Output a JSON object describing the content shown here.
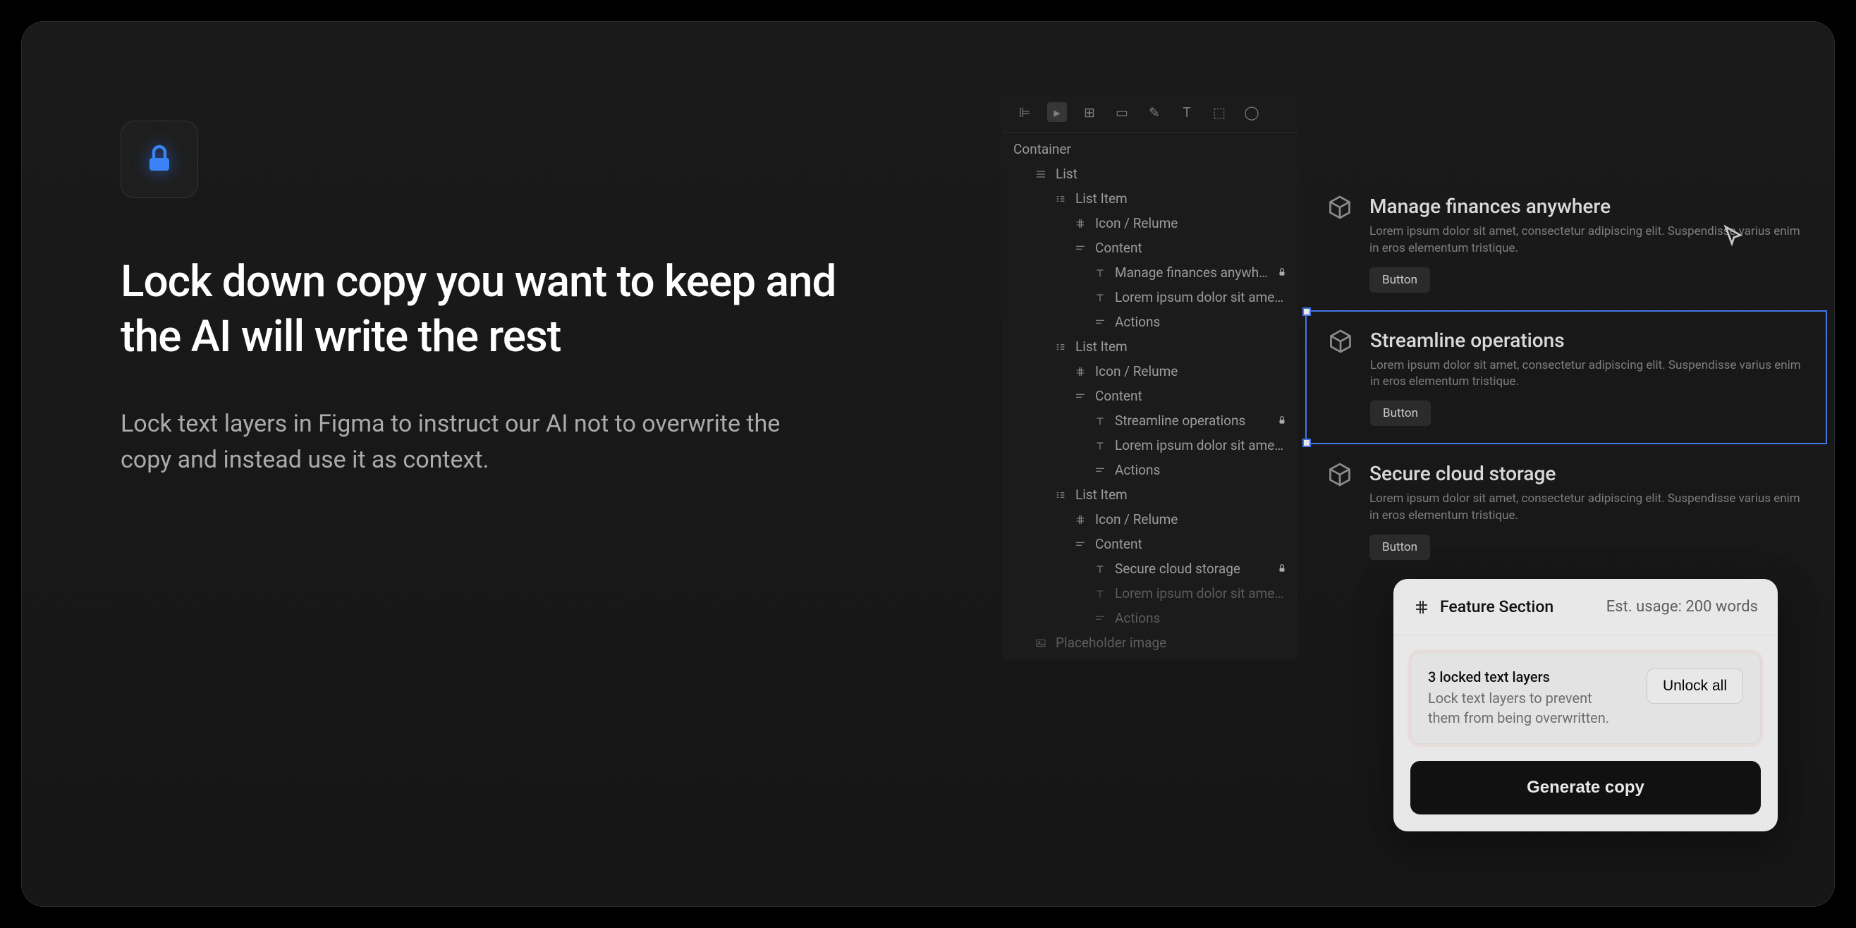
{
  "hero": {
    "heading": "Lock down copy you want to keep and the AI will write the rest",
    "subheading": "Lock text layers in Figma to instruct our AI not to overwrite the copy and instead use it as context."
  },
  "layers": {
    "root": "Container",
    "items": [
      {
        "indent": 1,
        "icon": "list",
        "label": "List"
      },
      {
        "indent": 2,
        "icon": "bars",
        "label": "List Item"
      },
      {
        "indent": 3,
        "icon": "hash",
        "label": "Icon / Relume"
      },
      {
        "indent": 3,
        "icon": "lines",
        "label": "Content"
      },
      {
        "indent": 4,
        "icon": "text",
        "label": "Manage finances anywhere",
        "locked": true
      },
      {
        "indent": 4,
        "icon": "text",
        "label": "Lorem ipsum dolor sit amet, conse..."
      },
      {
        "indent": 4,
        "icon": "lines",
        "label": "Actions"
      },
      {
        "indent": 2,
        "icon": "bars",
        "label": "List Item"
      },
      {
        "indent": 3,
        "icon": "hash",
        "label": "Icon / Relume"
      },
      {
        "indent": 3,
        "icon": "lines",
        "label": "Content"
      },
      {
        "indent": 4,
        "icon": "text",
        "label": "Streamline operations",
        "locked": true
      },
      {
        "indent": 4,
        "icon": "text",
        "label": "Lorem ipsum dolor sit amet, conse..."
      },
      {
        "indent": 4,
        "icon": "lines",
        "label": "Actions"
      },
      {
        "indent": 2,
        "icon": "bars",
        "label": "List Item"
      },
      {
        "indent": 3,
        "icon": "hash",
        "label": "Icon / Relume"
      },
      {
        "indent": 3,
        "icon": "lines",
        "label": "Content"
      },
      {
        "indent": 4,
        "icon": "text",
        "label": "Secure cloud storage",
        "locked": true
      },
      {
        "indent": 4,
        "icon": "text",
        "label": "Lorem ipsum dolor sit amet, conse...",
        "dimmed": true
      },
      {
        "indent": 4,
        "icon": "lines",
        "label": "Actions",
        "dimmed": true
      },
      {
        "indent": 1,
        "icon": "image",
        "label": "Placeholder image",
        "dimmed": true
      }
    ]
  },
  "preview": {
    "desc": "Lorem ipsum dolor sit amet, consectetur adipiscing elit. Suspendisse varius enim in eros elementum tristique.",
    "button": "Button",
    "items": [
      {
        "title": "Manage finances anywhere"
      },
      {
        "title": "Streamline operations"
      },
      {
        "title": "Secure cloud storage"
      }
    ]
  },
  "popup": {
    "title": "Feature Section",
    "usage": "Est. usage: 200 words",
    "locked_title": "3 locked text layers",
    "locked_desc": "Lock text layers to prevent them from being overwritten.",
    "unlock": "Unlock all",
    "generate": "Generate copy"
  }
}
